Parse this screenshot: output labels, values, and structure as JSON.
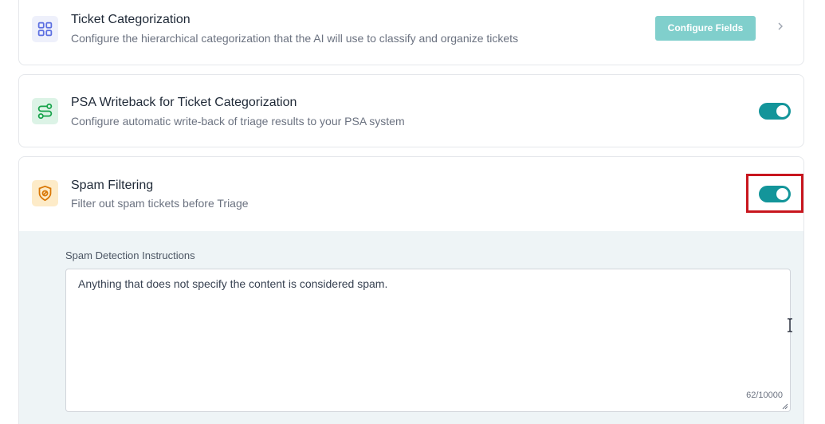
{
  "ticket_categorization": {
    "icon": "grid-icon",
    "title": "Ticket Categorization",
    "description": "Configure the hierarchical categorization that the AI will use to classify and organize tickets",
    "button_label": "Configure Fields",
    "accent": "#80cfcc"
  },
  "psa_writeback": {
    "icon": "route-icon",
    "title": "PSA Writeback for Ticket Categorization",
    "description": "Configure automatic write-back of triage results to your PSA system",
    "enabled": true
  },
  "spam_filtering": {
    "icon": "shield-ban-icon",
    "title": "Spam Filtering",
    "description": "Filter out spam tickets before Triage",
    "enabled": true,
    "instructions_label": "Spam Detection Instructions",
    "instructions_value": "Anything that does not specify the content is considered spam.",
    "char_count": "62/10000"
  },
  "colors": {
    "toggle_on": "#13959a",
    "highlight": "#c8161e",
    "panel_bg": "#eef4f6"
  }
}
